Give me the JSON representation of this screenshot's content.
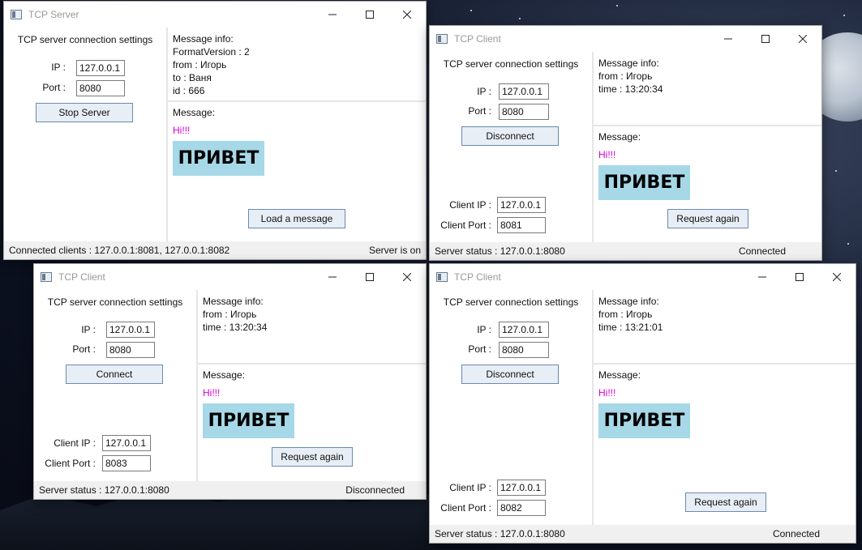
{
  "server": {
    "title": "TCP Server",
    "settings_title": "TCP server connection settings",
    "ip_label": "IP :",
    "ip_value": "127.0.0.1",
    "port_label": "Port :",
    "port_value": "8080",
    "button": "Stop Server",
    "info_header": "Message info:",
    "info_lines": [
      "FormatVersion : 2",
      "from : Игорь",
      "to : Ваня",
      "id : 666"
    ],
    "message_label": "Message:",
    "message_text": "Hi!!!",
    "image_text": "ПРИВЕТ",
    "load_button": "Load a message",
    "status_left": "Connected clients :  127.0.0.1:8081, 127.0.0.1:8082",
    "status_right": "Server is on"
  },
  "client1": {
    "title": "TCP Client",
    "settings_title": "TCP server connection settings",
    "ip_label": "IP :",
    "ip_value": "127.0.0.1",
    "port_label": "Port :",
    "port_value": "8080",
    "button": "Disconnect",
    "client_ip_label": "Client IP :",
    "client_ip_value": "127.0.0.1",
    "client_port_label": "Client Port :",
    "client_port_value": "8081",
    "info_header": "Message info:",
    "info_lines": [
      "from : Игорь",
      "time : 13:20:34"
    ],
    "message_label": "Message:",
    "message_text": "Hi!!!",
    "image_text": "ПРИВЕТ",
    "request_button": "Request again",
    "status_left": "Server status :  127.0.0.1:8080",
    "status_right": "Connected"
  },
  "client2": {
    "title": "TCP Client",
    "settings_title": "TCP server connection settings",
    "ip_label": "IP :",
    "ip_value": "127.0.0.1",
    "port_label": "Port :",
    "port_value": "8080",
    "button": "Connect",
    "client_ip_label": "Client IP :",
    "client_ip_value": "127.0.0.1",
    "client_port_label": "Client Port :",
    "client_port_value": "8083",
    "info_header": "Message info:",
    "info_lines": [
      "from : Игорь",
      "time : 13:20:34"
    ],
    "message_label": "Message:",
    "message_text": "Hi!!!",
    "image_text": "ПРИВЕТ",
    "request_button": "Request again",
    "status_left": "Server status :  127.0.0.1:8080",
    "status_right": "Disconnected"
  },
  "client3": {
    "title": "TCP Client",
    "settings_title": "TCP server connection settings",
    "ip_label": "IP :",
    "ip_value": "127.0.0.1",
    "port_label": "Port :",
    "port_value": "8080",
    "button": "Disconnect",
    "client_ip_label": "Client IP :",
    "client_ip_value": "127.0.0.1",
    "client_port_label": "Client Port :",
    "client_port_value": "8082",
    "info_header": "Message info:",
    "info_lines": [
      "from : Игорь",
      "time : 13:21:01"
    ],
    "message_label": "Message:",
    "message_text": "Hi!!!",
    "image_text": "ПРИВЕТ",
    "request_button": "Request again",
    "status_left": "Server status :  127.0.0.1:8080",
    "status_right": "Connected"
  },
  "colors": {
    "message_text": "#d400d4",
    "image_bg": "#a6d8e8",
    "button_bg": "#e8eef5",
    "status_bg": "#f0f0f0"
  },
  "icons": [
    "window-icon",
    "minimize-icon",
    "maximize-icon",
    "close-icon"
  ]
}
